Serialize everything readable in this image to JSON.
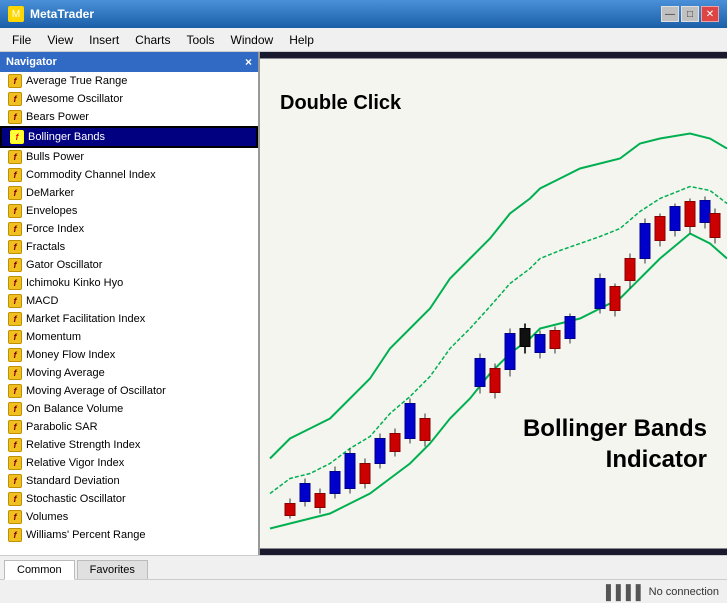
{
  "window": {
    "title": "MetaTrader",
    "controls": {
      "minimize": "—",
      "maximize": "□",
      "close": "✕"
    }
  },
  "menu": {
    "items": [
      "File",
      "View",
      "Insert",
      "Charts",
      "Tools",
      "Window",
      "Help"
    ]
  },
  "navigator": {
    "title": "Navigator",
    "close_label": "×",
    "items": [
      "Average True Range",
      "Awesome Oscillator",
      "Bears Power",
      "Bollinger Bands",
      "Bulls Power",
      "Commodity Channel Index",
      "DeMarker",
      "Envelopes",
      "Force Index",
      "Fractals",
      "Gator Oscillator",
      "Ichimoku Kinko Hyo",
      "MACD",
      "Market Facilitation Index",
      "Momentum",
      "Money Flow Index",
      "Moving Average",
      "Moving Average of Oscillator",
      "On Balance Volume",
      "Parabolic SAR",
      "Relative Strength Index",
      "Relative Vigor Index",
      "Standard Deviation",
      "Stochastic Oscillator",
      "Volumes",
      "Williams' Percent Range"
    ],
    "selected_item": "Bollinger Bands"
  },
  "chart": {
    "double_click_text": "Double Click",
    "indicator_label_line1": "Bollinger Bands",
    "indicator_label_line2": "Indicator"
  },
  "tabs": {
    "items": [
      "Common",
      "Favorites"
    ]
  },
  "status_bar": {
    "connection_text": "No connection",
    "bars_icon": "▐▐▐▐"
  }
}
